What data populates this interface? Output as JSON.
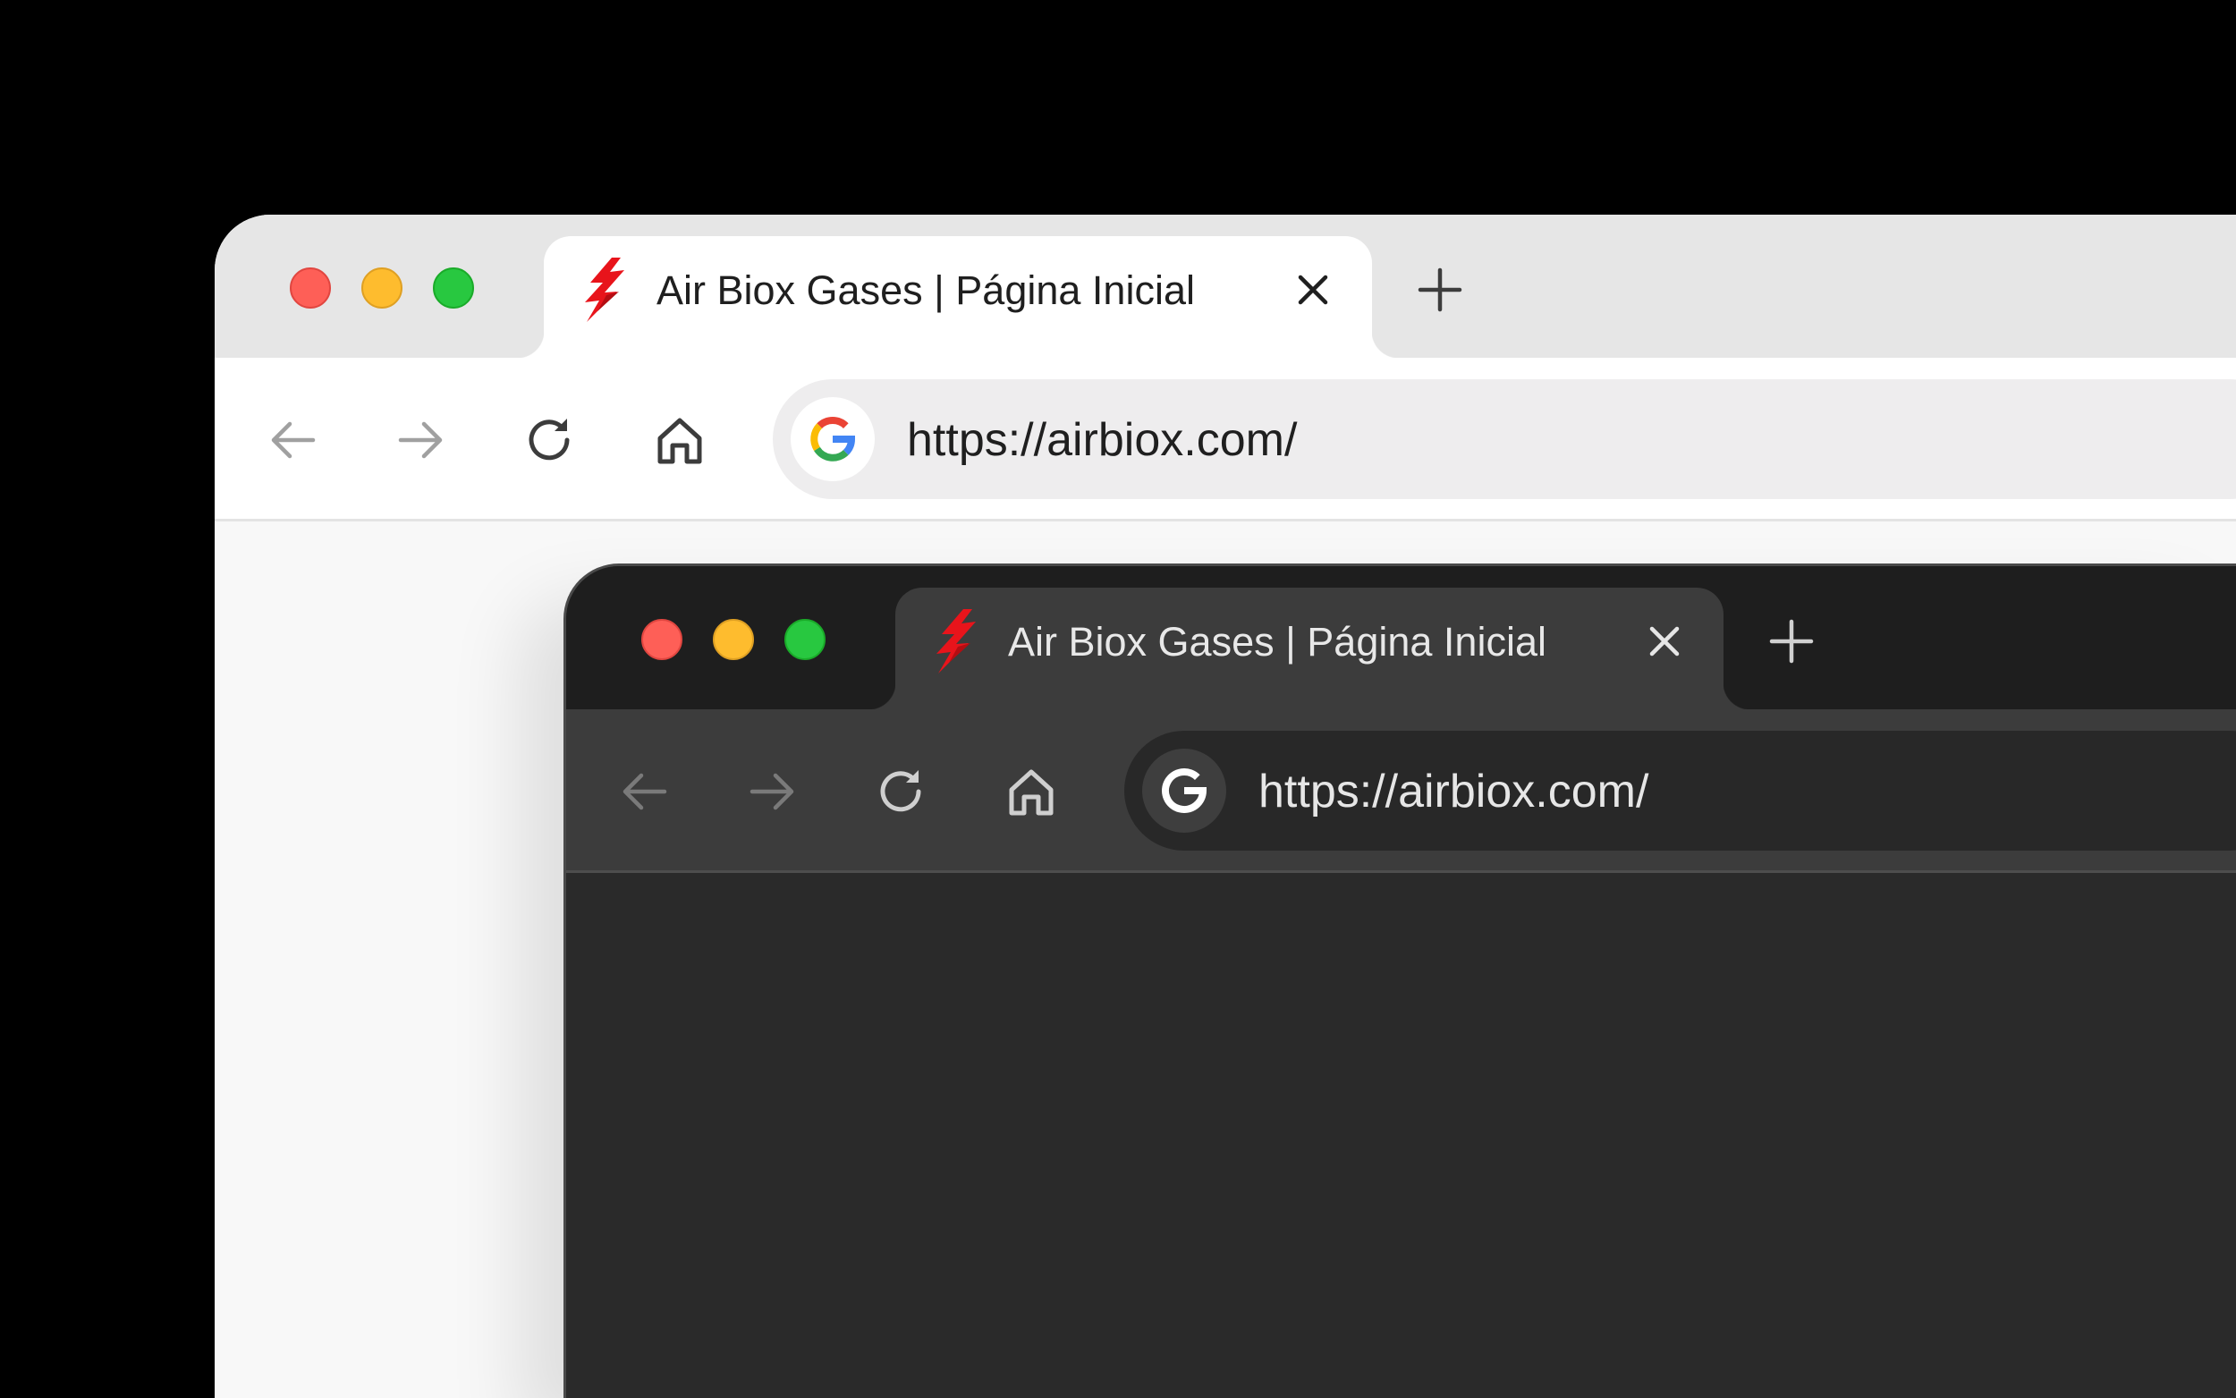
{
  "colors": {
    "background": "#000000",
    "light_tabbar": "#e6e6e6",
    "light_toolbar": "#ffffff",
    "light_omnibox": "#eeedee",
    "dark_tabbar": "#1e1e1e",
    "dark_toolbar": "#3c3c3c",
    "dark_omnibox": "#282828",
    "traffic_close": "#fe5f57",
    "traffic_minimize": "#febc2e",
    "traffic_zoom": "#28c840",
    "favicon_red": "#e8141b"
  },
  "light_browser": {
    "tab": {
      "favicon": "lightning-bolt-icon",
      "title": "Air Biox Gases | Página Inicial",
      "close_icon": "close-icon"
    },
    "new_tab_icon": "plus-icon",
    "toolbar": {
      "back_icon": "arrow-left-icon",
      "forward_icon": "arrow-right-icon",
      "reload_icon": "reload-icon",
      "home_icon": "home-icon"
    },
    "omnibox": {
      "badge_icon": "google-g-icon",
      "url": "https://airbiox.com/"
    }
  },
  "dark_browser": {
    "tab": {
      "favicon": "lightning-bolt-icon",
      "title": "Air Biox Gases | Página Inicial",
      "close_icon": "close-icon"
    },
    "new_tab_icon": "plus-icon",
    "toolbar": {
      "back_icon": "arrow-left-icon",
      "forward_icon": "arrow-right-icon",
      "reload_icon": "reload-icon",
      "home_icon": "home-icon"
    },
    "omnibox": {
      "badge_icon": "google-g-icon",
      "url": "https://airbiox.com/"
    }
  }
}
